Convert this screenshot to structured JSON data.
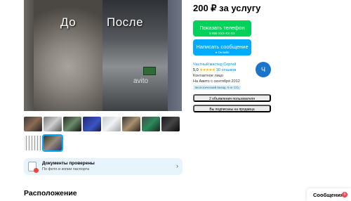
{
  "gallery": {
    "main_photo": {
      "label_before": "До",
      "label_after": "После",
      "watermark": "avito"
    },
    "thumbnails_count": 10,
    "active_thumbnail_index": 9
  },
  "docs_card": {
    "title": "Документы проверены",
    "subtitle": "По фото и копии паспорта",
    "arrow": "›"
  },
  "location": {
    "title": "Расположение"
  },
  "offer": {
    "price": "200 ₽ за услугу",
    "phone_button": {
      "label": "Показать телефон",
      "masked_number": "8 999 XXX-XX-XX"
    },
    "message_button": {
      "label": "Написать сообщение",
      "status": "● Онлайн"
    }
  },
  "seller": {
    "role": "Частный мастер Сергей",
    "rating": "5,0",
    "stars": "★★★★★",
    "reviews": "30 отзывов",
    "contact_type": "Контактное лицо",
    "since": "На Авито с сентября 2012",
    "eco_badge": "Экологический вклад -5 кг CO₂",
    "avatar_letter": "Ч",
    "listings_button": "2 объявления пользователя",
    "subscribed_button": "Вы подписаны на продавца"
  },
  "messages_widget": {
    "label": "Сообщения",
    "badge_count": "9"
  },
  "colors": {
    "phone_button": "#02d15c",
    "message_button": "#00aaff",
    "avatar": "#1a74c9",
    "badge": "#ff4053"
  }
}
